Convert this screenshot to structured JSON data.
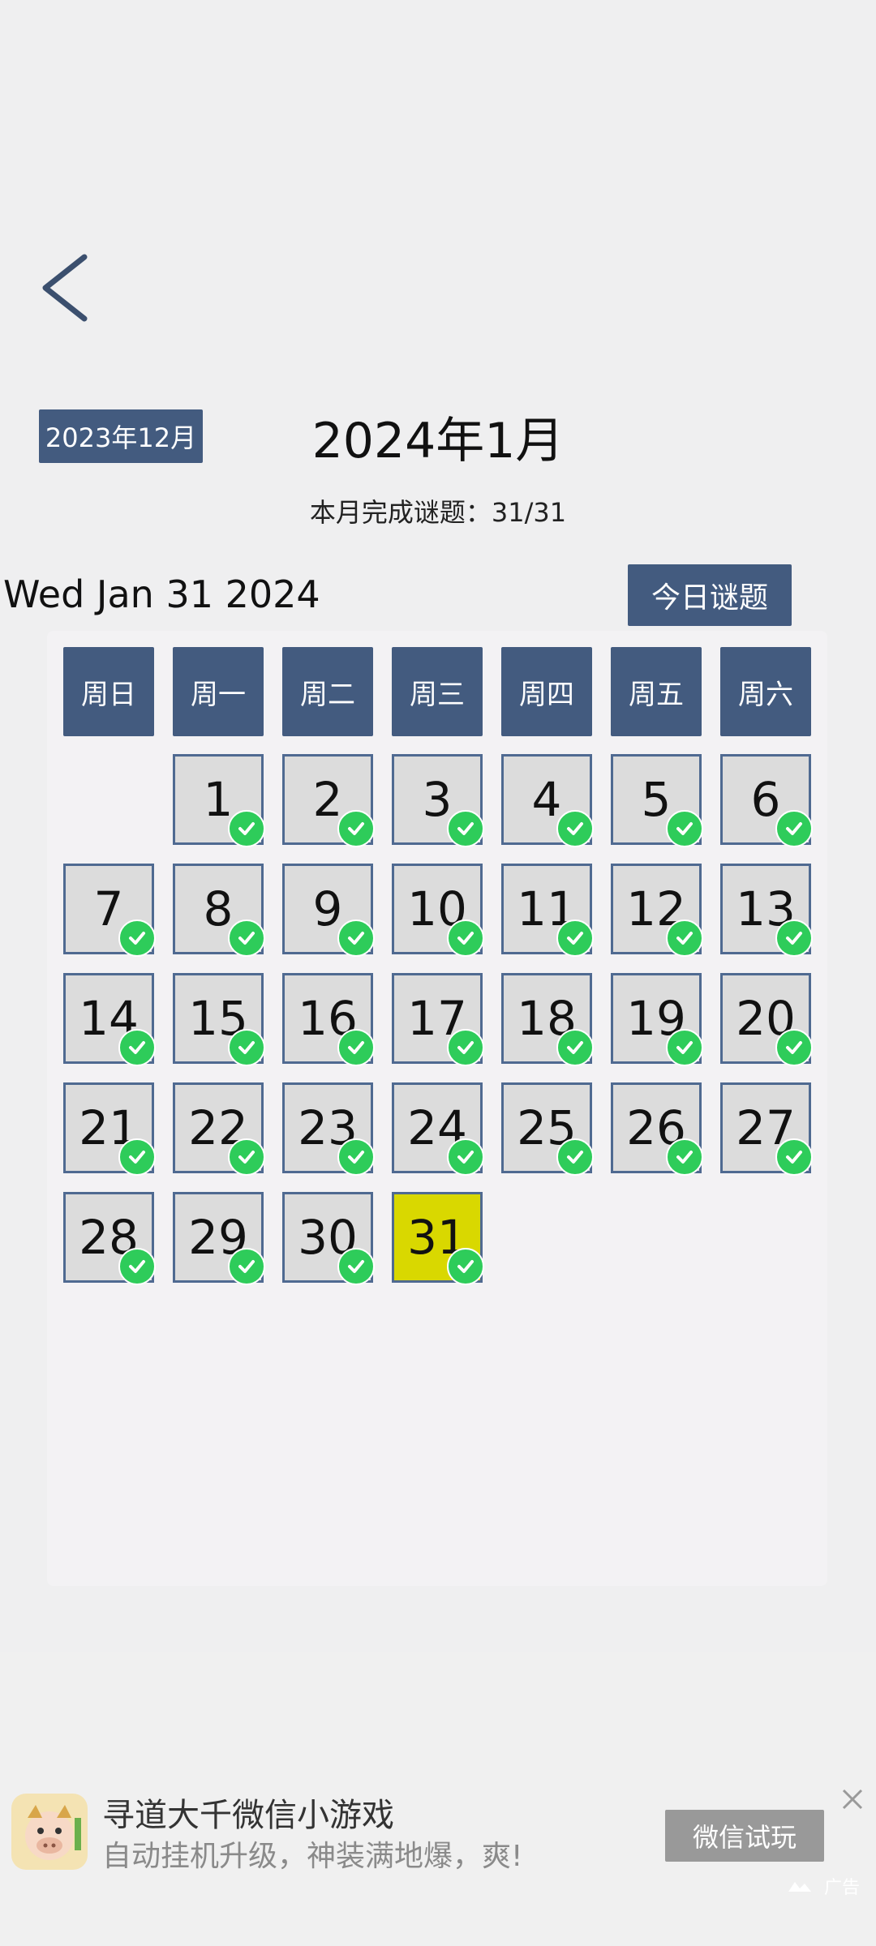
{
  "nav": {
    "back_icon": "chevron-left-icon"
  },
  "calendar": {
    "prev_month_label": "2023年12月",
    "title": "2024年1月",
    "progress_text": "本月完成谜题：31/31",
    "today_date": "Wed Jan 31 2024",
    "today_puzzle_label": "今日谜题",
    "weekdays": [
      "周日",
      "周一",
      "周二",
      "周三",
      "周四",
      "周五",
      "周六"
    ],
    "first_weekday_index": 1,
    "days": [
      {
        "label": "1",
        "completed": true,
        "today": false
      },
      {
        "label": "2",
        "completed": true,
        "today": false
      },
      {
        "label": "3",
        "completed": true,
        "today": false
      },
      {
        "label": "4",
        "completed": true,
        "today": false
      },
      {
        "label": "5",
        "completed": true,
        "today": false
      },
      {
        "label": "6",
        "completed": true,
        "today": false
      },
      {
        "label": "7",
        "completed": true,
        "today": false
      },
      {
        "label": "8",
        "completed": true,
        "today": false
      },
      {
        "label": "9",
        "completed": true,
        "today": false
      },
      {
        "label": "10",
        "completed": true,
        "today": false
      },
      {
        "label": "11",
        "completed": true,
        "today": false
      },
      {
        "label": "12",
        "completed": true,
        "today": false
      },
      {
        "label": "13",
        "completed": true,
        "today": false
      },
      {
        "label": "14",
        "completed": true,
        "today": false
      },
      {
        "label": "15",
        "completed": true,
        "today": false
      },
      {
        "label": "16",
        "completed": true,
        "today": false
      },
      {
        "label": "17",
        "completed": true,
        "today": false
      },
      {
        "label": "18",
        "completed": true,
        "today": false
      },
      {
        "label": "19",
        "completed": true,
        "today": false
      },
      {
        "label": "20",
        "completed": true,
        "today": false
      },
      {
        "label": "21",
        "completed": true,
        "today": false
      },
      {
        "label": "22",
        "completed": true,
        "today": false
      },
      {
        "label": "23",
        "completed": true,
        "today": false
      },
      {
        "label": "24",
        "completed": true,
        "today": false
      },
      {
        "label": "25",
        "completed": true,
        "today": false
      },
      {
        "label": "26",
        "completed": true,
        "today": false
      },
      {
        "label": "27",
        "completed": true,
        "today": false
      },
      {
        "label": "28",
        "completed": true,
        "today": false
      },
      {
        "label": "29",
        "completed": true,
        "today": false
      },
      {
        "label": "30",
        "completed": true,
        "today": false
      },
      {
        "label": "31",
        "completed": true,
        "today": true
      }
    ],
    "colors": {
      "header_bg": "#435b7f",
      "cell_bg": "#dcdcdc",
      "cell_border": "#4f6a91",
      "today_bg": "#d9d800",
      "check_bg": "#2ecc5a"
    }
  },
  "ad": {
    "title": "寻道大千微信小游戏",
    "subtitle": "自动挂机升级，神装满地爆，爽!",
    "cta_label": "微信试玩",
    "badge_label": "广告",
    "close_icon": "close-icon"
  }
}
